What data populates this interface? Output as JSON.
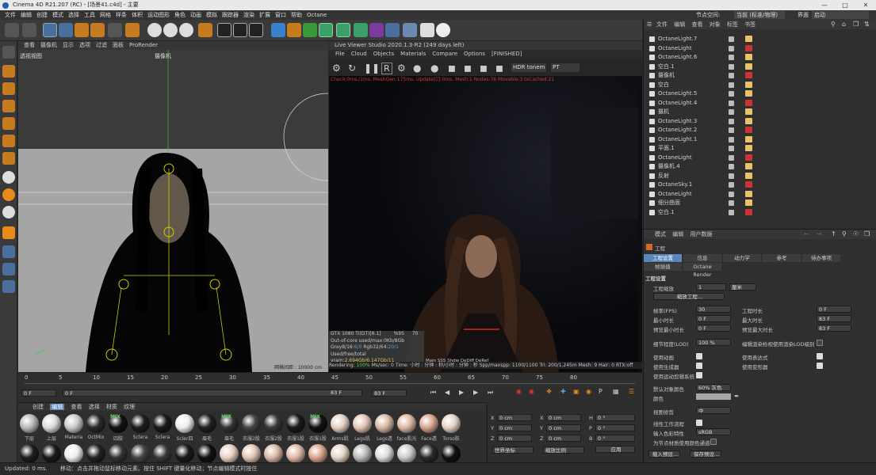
{
  "title": "Cinema 4D R21.207 (RC) - [场景41.c4d] - 主要",
  "menu": [
    "文件",
    "编辑",
    "创建",
    "模式",
    "选择",
    "工具",
    "网格",
    "样条",
    "体积",
    "运动图形",
    "角色",
    "动画",
    "模拟",
    "跟踪器",
    "渲染",
    "扩展",
    "窗口",
    "帮助",
    "Octane"
  ],
  "node_space_label": "节点空间:",
  "node_space_value": "当前 (标准/物理)",
  "layout_label": "界面",
  "layout_value": "启动",
  "vp1": {
    "menu": [
      "查看",
      "摄像机",
      "显示",
      "选项",
      "过滤",
      "面板",
      "ProRender"
    ],
    "name": "透视视图",
    "camera": "摄像机",
    "grid_spacing": "网格间距 : 10000 cm"
  },
  "lv": {
    "title": "Live Viewer Studio 2020.1.3-R2 (249 days left)",
    "menu": [
      "File",
      "Cloud",
      "Objects",
      "Materials",
      "Compare",
      "Options"
    ],
    "status": "[FINISHED]",
    "tonemap": "HDR tonem",
    "mode": "PT",
    "check": "Check:0ms./1ms. MeshGen:175ms. Update[C]:0ms. Mesh:1 Nodes:76 Movable:3 txCached:21",
    "gpu": "GTX 1080 Ti(DT)[6.1]",
    "gpu_pct": "%95",
    "gpu_temp": "70",
    "ooc": "Out-of-core used/max:0Kb/8Gb",
    "grey": "Grey8/16:",
    "grey_val": "6/0",
    "rgb": "Rgb32/64:",
    "rgb_val": "20/1",
    "vram": "Used/free/total vram:",
    "vram_val": "2.694Gb/6.147Gb/11",
    "mini": [
      "Main",
      "SSS",
      "Shdw",
      "DeDiff",
      "DeRef"
    ],
    "rendering": "Rendering:",
    "rendering_pct": "100%",
    "mssec": "Ms/sec: 0",
    "time": "Time: 小时 : 分钟 : 秒/小时 : 分钟 : 秒",
    "spp": "Spp/maxspp: 1100/1100",
    "tri": "Tri: 200/1.245m",
    "mesh": "Mesh: 9",
    "hair": "Hair: 0",
    "rtx": "RTX:off"
  },
  "timeline": {
    "ticks": [
      "0",
      "5",
      "10",
      "15",
      "20",
      "25",
      "30",
      "35",
      "40",
      "45",
      "50",
      "55",
      "60",
      "65",
      "70",
      "75",
      "80"
    ],
    "start": "0 F",
    "cur": "0 F",
    "end": "83 F",
    "end2": "83 F",
    "frame": "0 F"
  },
  "materials": {
    "menu": [
      "创建",
      "编辑",
      "查看",
      "选择",
      "材质",
      "纹理"
    ],
    "row1": [
      "下层",
      "上层",
      "Materia",
      "OctMix",
      "四肢",
      "Sclera",
      "Sclera",
      "Scler四",
      "眉毛",
      "眉毛",
      "衣服2股",
      "衣服2股",
      "衣服1股",
      "衣服1股",
      "Arms肌",
      "Legs肌",
      "Legs透",
      "face肌光",
      "Face透",
      "Torso肤"
    ],
    "row1_mix": [
      "OctMix",
      "眉毛",
      "衣服1股"
    ],
    "mix": "MIX"
  },
  "coords": {
    "labels": [
      "X",
      "Y",
      "Z"
    ],
    "v1": [
      "0 cm",
      "0 cm",
      "0 cm"
    ],
    "l2": [
      "X",
      "Y",
      "Z"
    ],
    "v2": [
      "0 cm",
      "0 cm",
      "0 cm"
    ],
    "l3": [
      "H",
      "P",
      "B"
    ],
    "v3": [
      "0 °",
      "0 °",
      "0 °"
    ],
    "sel1": "世界坐标",
    "sel2": "缩放比例",
    "apply": "应用"
  },
  "status": {
    "left": "Updated: 0 ms.",
    "msg": "移动：点击并拖动鼠标移动元素。按住 SHIFT 键量化移动；节点编辑模式时按住"
  },
  "objmgr": {
    "menu": [
      "文件",
      "编辑",
      "查看",
      "对象",
      "标签",
      "书签"
    ],
    "rows": [
      "OctaneLight.7",
      "OctaneLight",
      "OctaneLight.6",
      "空白.1",
      "摄像机",
      "空白",
      "OctaneLight.5",
      "OctaneLight.4",
      "摄机",
      "OctaneLight.3",
      "OctaneLight.2",
      "OctaneLight.1",
      "平面.1",
      "OctaneLight",
      "摄像机.4",
      "反射",
      "OctaneSky.1",
      "OctaneLight",
      "细分曲面",
      "空白.1"
    ]
  },
  "attr": {
    "menu": [
      "模式",
      "编辑",
      "用户数据"
    ],
    "title": "工程",
    "tabs": [
      "工程设置",
      "信息",
      "动力学",
      "参考",
      "待办事项"
    ],
    "tabs2": [
      "帧插值",
      "Octane Render"
    ],
    "section": "工程设置",
    "scale_label": "工程缩放",
    "scale_val": "1",
    "scale_unit": "厘米",
    "scale_btn": "缩放工程...",
    "fps_label": "帧率(FPS)",
    "fps": "30",
    "len_label": "工程时长",
    "len": "0 F",
    "min_label": "最小时长",
    "min": "0 F",
    "max_label": "最大时长",
    "max": "83 F",
    "pmin_label": "预览最小时长",
    "pmin": "0 F",
    "pmax_label": "预览最大时长",
    "pmax": "83 F",
    "lod_label": "细节程度(LOD)",
    "lod": "100 %",
    "lod_chk": "编辑渲染检视使用渲染LOD级别",
    "anim": "使用动画",
    "expr": "使用表达式",
    "gen": "使用生成器",
    "deform": "使用变形器",
    "motion": "使用运动剪辑系统",
    "objcolor_label": "默认对象颜色",
    "objcolor": "60% 灰色",
    "color_label": "颜色",
    "clip_label": "视图修剪",
    "clip": "中",
    "linear": "线性工作流程",
    "input_label": "输入色彩特性",
    "input": "sRGB",
    "node_color": "为节点材质使用颜色通道",
    "load": "载入预设...",
    "save": "保存预设..."
  }
}
